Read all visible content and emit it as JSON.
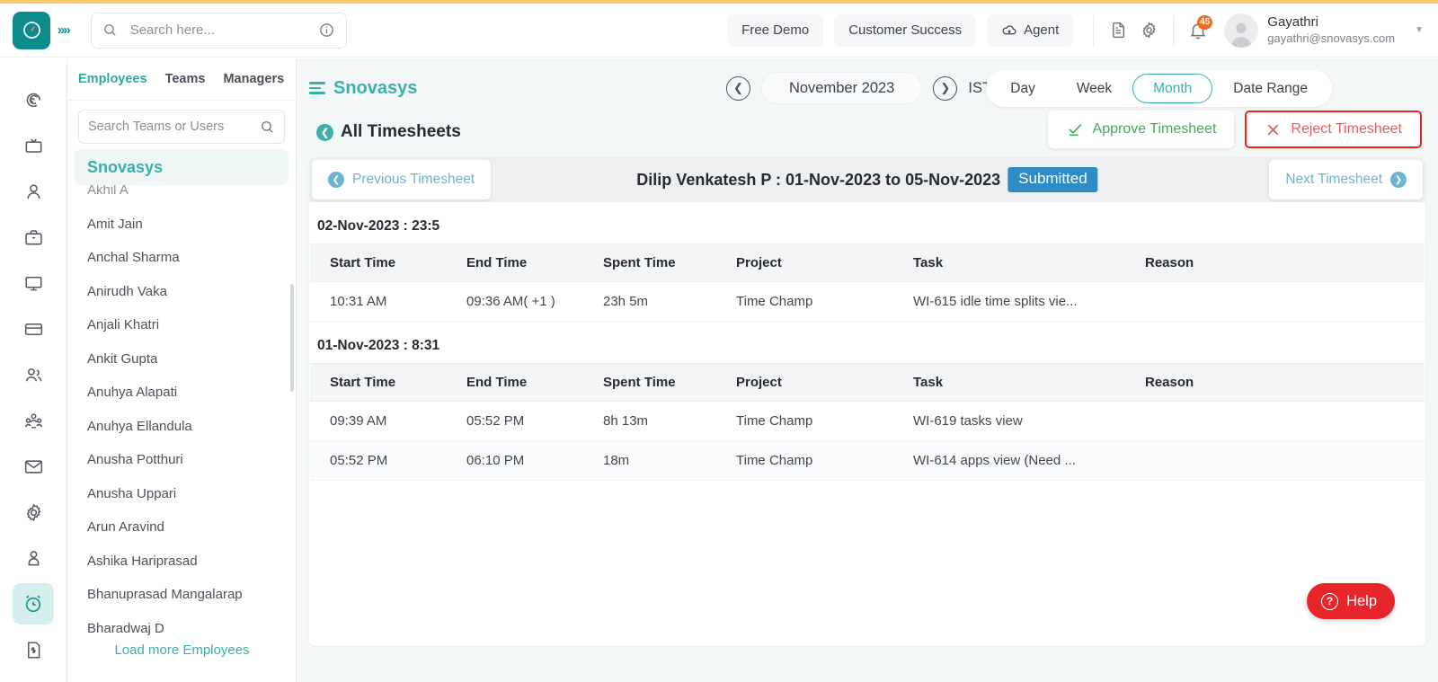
{
  "header": {
    "logo_icon": "clock-logo-icon",
    "expand_icon": "chevron-double-right-icon",
    "search": {
      "placeholder": "Search here...",
      "value": "",
      "icon": "search-icon",
      "info_icon": "info-icon"
    },
    "buttons": [
      {
        "label": "Free Demo",
        "name": "free-demo-button",
        "icon": null
      },
      {
        "label": "Customer Success",
        "name": "customer-success-button",
        "icon": null
      },
      {
        "label": "Agent",
        "name": "agent-button",
        "icon": "cloud-download-icon"
      }
    ],
    "icons": [
      {
        "name": "document-icon"
      },
      {
        "name": "gear-icon"
      },
      {
        "name": "bell-icon",
        "badge": "45"
      }
    ],
    "user": {
      "name": "Gayathri",
      "email": "gayathri@snovasys.com",
      "avatar_icon": "avatar-icon",
      "caret_icon": "chevron-down-icon"
    }
  },
  "rail": {
    "items": [
      {
        "name": "sidebar-item-dashboard",
        "icon": "spiral-icon",
        "active": false
      },
      {
        "name": "sidebar-item-screenshots",
        "icon": "tv-icon",
        "active": false
      },
      {
        "name": "sidebar-item-user",
        "icon": "person-icon",
        "active": false
      },
      {
        "name": "sidebar-item-projects",
        "icon": "briefcase-icon",
        "active": false
      },
      {
        "name": "sidebar-item-monitor",
        "icon": "monitor-icon",
        "active": false
      },
      {
        "name": "sidebar-item-payments",
        "icon": "credit-card-icon",
        "active": false
      },
      {
        "name": "sidebar-item-teams",
        "icon": "two-people-icon",
        "active": false
      },
      {
        "name": "sidebar-item-organization",
        "icon": "group-people-icon",
        "active": false
      },
      {
        "name": "sidebar-item-mail",
        "icon": "envelope-icon",
        "active": false
      },
      {
        "name": "sidebar-item-settings",
        "icon": "gear-icon",
        "active": false
      },
      {
        "name": "sidebar-item-profile",
        "icon": "person-badge-icon",
        "active": false
      },
      {
        "name": "sidebar-item-timesheets",
        "icon": "alarm-clock-icon",
        "active": true
      },
      {
        "name": "sidebar-item-invoices",
        "icon": "invoice-icon",
        "active": false
      }
    ]
  },
  "employees_panel": {
    "tabs": [
      {
        "label": "Employees",
        "active": true
      },
      {
        "label": "Teams",
        "active": false
      },
      {
        "label": "Managers",
        "active": false
      }
    ],
    "search": {
      "placeholder": "Search Teams or Users",
      "value": "",
      "icon": "search-icon"
    },
    "group": "Snovasys",
    "items": [
      "Akhil A",
      "Amit Jain",
      "Anchal Sharma",
      "Anirudh Vaka",
      "Anjali Khatri",
      "Ankit Gupta",
      "Anuhya Alapati",
      "Anuhya Ellandula",
      "Anusha Potthuri",
      "Anusha Uppari",
      "Arun Aravind",
      "Ashika Hariprasad",
      "Bhanuprasad Mangalarap",
      "Bharadwaj D"
    ],
    "load_more": "Load more Employees"
  },
  "main": {
    "org_name": "Snovasys",
    "menu_icon": "hamburger-icon",
    "date_nav": {
      "prev_icon": "chevron-left-icon",
      "next_icon": "chevron-right-icon",
      "current": "November 2023",
      "timezone": "IST",
      "timezone_caret": "chevron-down-icon"
    },
    "view_toggle": [
      {
        "label": "Day",
        "active": false
      },
      {
        "label": "Week",
        "active": false
      },
      {
        "label": "Month",
        "active": true
      },
      {
        "label": "Date Range",
        "active": false
      }
    ],
    "breadcrumb": {
      "label": "All Timesheets",
      "icon": "back-arrow-icon"
    },
    "actions": {
      "approve": {
        "label": "Approve Timesheet",
        "icon": "check-icon",
        "color": "#3fae54"
      },
      "reject": {
        "label": "Reject Timesheet",
        "icon": "cross-icon",
        "color": "#ea5a5a",
        "highlight_border": "#f4201f"
      }
    },
    "timesheet_nav": {
      "previous": "Previous Timesheet",
      "next": "Next Timesheet",
      "title": "Dilip Venkatesh P : 01-Nov-2023 to 05-Nov-2023",
      "status": "Submitted",
      "status_color": "#2e8bc4"
    },
    "columns": [
      "Start Time",
      "End Time",
      "Spent Time",
      "Project",
      "Task",
      "Reason"
    ],
    "days": [
      {
        "heading": "02-Nov-2023 : 23:5",
        "rows": [
          {
            "start_time": "10:31 AM",
            "end_time": "09:36 AM( +1 )",
            "spent_time": "23h 5m",
            "project": "Time Champ",
            "task": "WI-615 idle time splits vie...",
            "reason": ""
          }
        ]
      },
      {
        "heading": "01-Nov-2023 : 8:31",
        "rows": [
          {
            "start_time": "09:39 AM",
            "end_time": "05:52 PM",
            "spent_time": "8h 13m",
            "project": "Time Champ",
            "task": "WI-619 tasks view",
            "reason": ""
          },
          {
            "start_time": "05:52 PM",
            "end_time": "06:10 PM",
            "spent_time": "18m",
            "project": "Time Champ",
            "task": "WI-614 apps view (Need ...",
            "reason": ""
          }
        ]
      }
    ],
    "help": {
      "label": "Help",
      "icon": "question-mark-icon",
      "color": "#e8252b"
    }
  }
}
